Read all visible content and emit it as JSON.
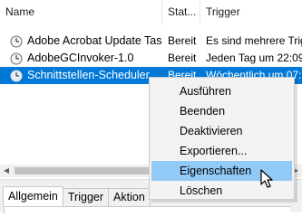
{
  "header": {
    "name": "Name",
    "status": "Stat...",
    "trigger": "Trigger"
  },
  "tasks": [
    {
      "name": "Adobe Acrobat Update Task",
      "status": "Bereit",
      "trigger": "Es sind mehrere Trigg",
      "icon": "clock-icon"
    },
    {
      "name": "AdobeGCInvoker-1.0",
      "status": "Bereit",
      "trigger": "Jeden Tag um 22:09 U",
      "icon": "clock-icon"
    },
    {
      "name": "Schnittstellen-Scheduler",
      "status": "Bereit",
      "trigger": "Wöchentlich um 07:...",
      "icon": "clock-icon",
      "selected": true
    }
  ],
  "context_menu": {
    "items": [
      "Ausführen",
      "Beenden",
      "Deaktivieren",
      "Exportieren...",
      "Eigenschaften",
      "Löschen"
    ],
    "hovered": "Eigenschaften"
  },
  "lower_panel": {
    "tabs": [
      "Allgemein",
      "Trigger",
      "Aktion"
    ],
    "active_tab": "Allgemein"
  },
  "colors": {
    "selection": "#0078d7",
    "menu_hover": "#91c9f7",
    "menu_background": "#f2f2f2"
  }
}
